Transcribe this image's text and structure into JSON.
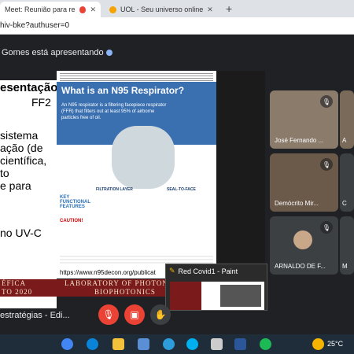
{
  "browser": {
    "tabs": [
      {
        "label": "Meet: Reunião para resultado",
        "active": true
      },
      {
        "label": "UOL - Seu universo online",
        "active": false
      }
    ],
    "address": "hiv-bke?authuser=0"
  },
  "meet": {
    "presenting_label": "Gomes está apresentando",
    "meeting_name": "estratégias - Edi...",
    "participants": [
      "José Fernando ...",
      "Demócrito Mir...",
      "ARNALDO DE F..."
    ],
    "participant_partial": [
      "A",
      "C",
      "M"
    ]
  },
  "slide": {
    "left_lines": [
      "esentação:",
      "FF2",
      "sistema",
      "ação (de",
      "científica,",
      "to",
      "e para",
      "no UV-C"
    ],
    "banner": "LABORATORY OF PHOTONICS AND",
    "banner2": "BIOPHOTONICS",
    "banner_left": "ÉFICA",
    "banner_left2": "TO 2020",
    "poster_title": "What is an N95 Respirator?",
    "poster_subtitle": "An N95 respirator is a filtering facepiece respirator (FFR) that filters out at least 95% of airborne particles free of oil.",
    "poster_filtration": "FILTRATION LAYER",
    "poster_seal": "SEAL-TO-FACE",
    "poster_key": "KEY FUNCTIONAL FEATURES",
    "poster_caution": "CAUTION!",
    "caption": "https://www.n95decon.org/publicat"
  },
  "paint": {
    "title": "Red Covid1 - Paint"
  },
  "taskbar": {
    "temperature": "25°C"
  },
  "colors": {
    "meet_bg": "#202124",
    "end_call": "#ea4335",
    "taskbar": "#1f2d3a"
  }
}
